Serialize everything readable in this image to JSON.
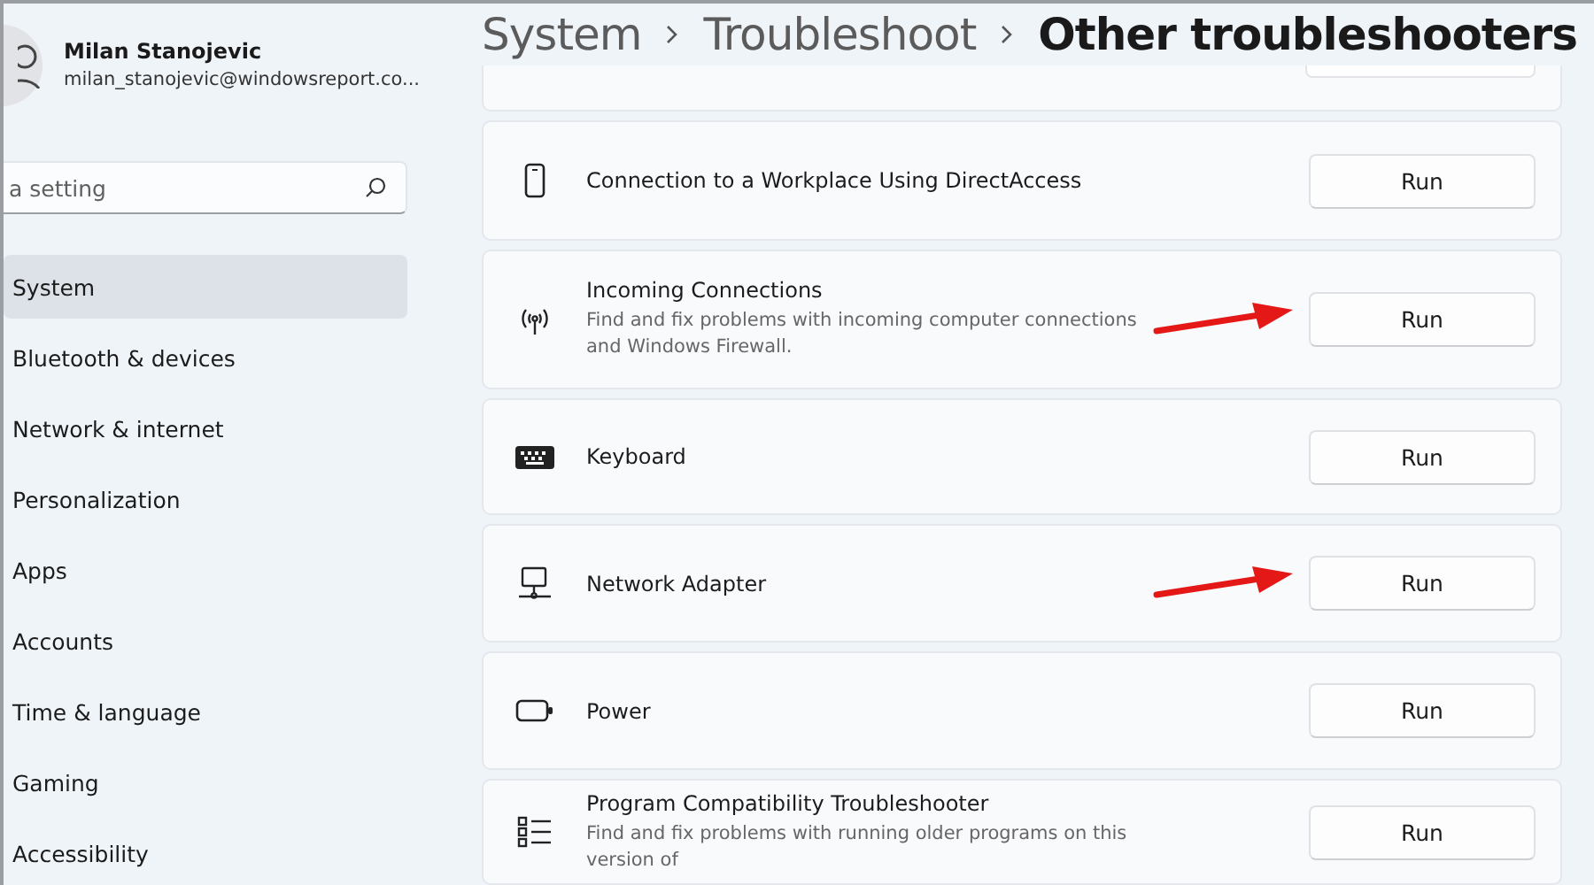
{
  "user": {
    "name": "Milan Stanojevic",
    "email": "milan_stanojevic@windowsreport.co..."
  },
  "search": {
    "placeholder": "a setting"
  },
  "nav": [
    {
      "label": "System",
      "selected": true
    },
    {
      "label": "Bluetooth & devices",
      "selected": false
    },
    {
      "label": "Network & internet",
      "selected": false
    },
    {
      "label": "Personalization",
      "selected": false
    },
    {
      "label": "Apps",
      "selected": false
    },
    {
      "label": "Accounts",
      "selected": false
    },
    {
      "label": "Time & language",
      "selected": false
    },
    {
      "label": "Gaming",
      "selected": false
    },
    {
      "label": "Accessibility",
      "selected": false
    }
  ],
  "breadcrumb": [
    "System",
    "Troubleshoot",
    "Other troubleshooters"
  ],
  "troubleshooters": [
    {
      "title": "Connection to a Workplace Using DirectAccess",
      "button": "Run",
      "arrow": false
    },
    {
      "title": "Incoming Connections",
      "description": "Find and fix problems with incoming computer connections and Windows Firewall.",
      "button": "Run",
      "arrow": true
    },
    {
      "title": "Keyboard",
      "button": "Run",
      "arrow": false
    },
    {
      "title": "Network Adapter",
      "button": "Run",
      "arrow": true
    },
    {
      "title": "Power",
      "button": "Run",
      "arrow": false
    },
    {
      "title": "Program Compatibility Troubleshooter",
      "description": "Find and fix problems with running older programs on this version of",
      "button": "Run",
      "arrow": false
    }
  ]
}
